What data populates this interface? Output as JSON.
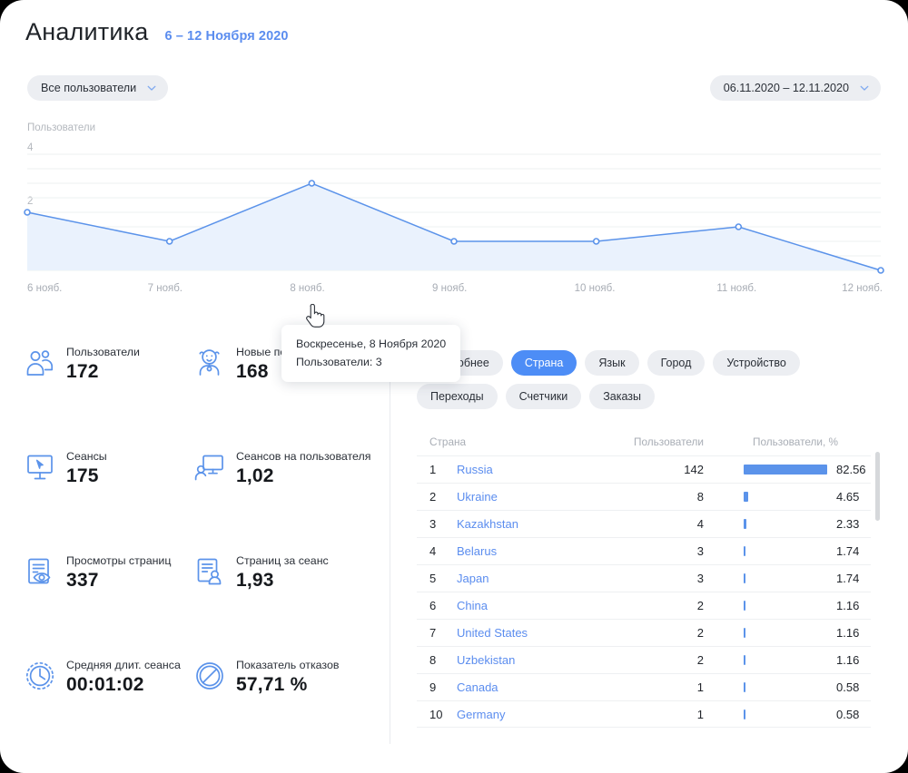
{
  "header": {
    "title": "Аналитика",
    "date_range_label": "6 – 12 Ноября 2020"
  },
  "filters": {
    "user_segment": "Все пользователи",
    "date_range": "06.11.2020 – 12.11.2020",
    "chevron_icon": "chevron-down-icon"
  },
  "chart_data": {
    "type": "area",
    "title": "Пользователи",
    "ylabel": "Пользователи",
    "xlabel": "",
    "categories": [
      "6 нояб.",
      "7 нояб.",
      "8 нояб.",
      "9 нояб.",
      "10 нояб.",
      "11 нояб.",
      "12 нояб."
    ],
    "values": [
      2,
      1,
      3,
      1,
      1,
      1.5,
      0
    ],
    "ylim": [
      0,
      4
    ],
    "ytick_labels": [
      "4",
      "2"
    ],
    "ytick_values": [
      4,
      2
    ],
    "grid": true,
    "legend": "none",
    "series": [
      {
        "name": "Пользователи",
        "values": [
          2,
          1,
          3,
          1,
          1,
          1.5,
          0
        ]
      }
    ],
    "line_color": "#5b93ea",
    "fill_color": "#eaf2fd",
    "hovered_index": 2,
    "tooltip": {
      "date": "Воскресенье, 8 Ноября 2020",
      "metric": "Пользователи: 3"
    }
  },
  "metrics": [
    {
      "icon": "users-icon",
      "label": "Пользователи",
      "value": "172"
    },
    {
      "icon": "new-user-baby-icon",
      "label": "Новые пользователи",
      "value": "168"
    },
    {
      "icon": "sessions-cursor-icon",
      "label": "Сеансы",
      "value": "175"
    },
    {
      "icon": "sessions-per-user-icon",
      "label": "Сеансов на пользователя",
      "value": "1,02"
    },
    {
      "icon": "pageviews-eye-icon",
      "label": "Просмотры страниц",
      "value": "337"
    },
    {
      "icon": "pages-per-session-icon",
      "label": "Страниц за сеанс",
      "value": "1,93"
    },
    {
      "icon": "clock-icon",
      "label": "Средняя длит. сеанса",
      "value": "00:01:02"
    },
    {
      "icon": "bounce-rate-icon",
      "label": "Показатель отказов",
      "value": "57,71 %"
    }
  ],
  "tabs": [
    {
      "label": "Подробнее",
      "active": false
    },
    {
      "label": "Страна",
      "active": true
    },
    {
      "label": "Язык",
      "active": false
    },
    {
      "label": "Город",
      "active": false
    },
    {
      "label": "Устройство",
      "active": false
    },
    {
      "label": "Переходы",
      "active": false
    },
    {
      "label": "Счетчики",
      "active": false
    },
    {
      "label": "Заказы",
      "active": false
    }
  ],
  "table": {
    "columns": [
      "Страна",
      "Пользователи",
      "Пользователи, %"
    ],
    "rows": [
      {
        "rank": "1",
        "name": "Russia",
        "users": "142",
        "pct": "82.56",
        "pct_num": 82.56
      },
      {
        "rank": "2",
        "name": "Ukraine",
        "users": "8",
        "pct": "4.65",
        "pct_num": 4.65
      },
      {
        "rank": "3",
        "name": "Kazakhstan",
        "users": "4",
        "pct": "2.33",
        "pct_num": 2.33
      },
      {
        "rank": "4",
        "name": "Belarus",
        "users": "3",
        "pct": "1.74",
        "pct_num": 1.74
      },
      {
        "rank": "5",
        "name": "Japan",
        "users": "3",
        "pct": "1.74",
        "pct_num": 1.74
      },
      {
        "rank": "6",
        "name": "China",
        "users": "2",
        "pct": "1.16",
        "pct_num": 1.16
      },
      {
        "rank": "7",
        "name": "United States",
        "users": "2",
        "pct": "1.16",
        "pct_num": 1.16
      },
      {
        "rank": "8",
        "name": "Uzbekistan",
        "users": "2",
        "pct": "1.16",
        "pct_num": 1.16
      },
      {
        "rank": "9",
        "name": "Canada",
        "users": "1",
        "pct": "0.58",
        "pct_num": 0.58
      },
      {
        "rank": "10",
        "name": "Germany",
        "users": "1",
        "pct": "0.58",
        "pct_num": 0.58
      }
    ]
  },
  "colors": {
    "accent": "#5b8def",
    "tab_active": "#4d8df6",
    "chip_bg": "#eceef2",
    "bar": "#5b93ea",
    "chart_line": "#5b93ea",
    "chart_fill": "#eaf2fd",
    "text": "#22262c",
    "muted": "#a8adb5"
  }
}
